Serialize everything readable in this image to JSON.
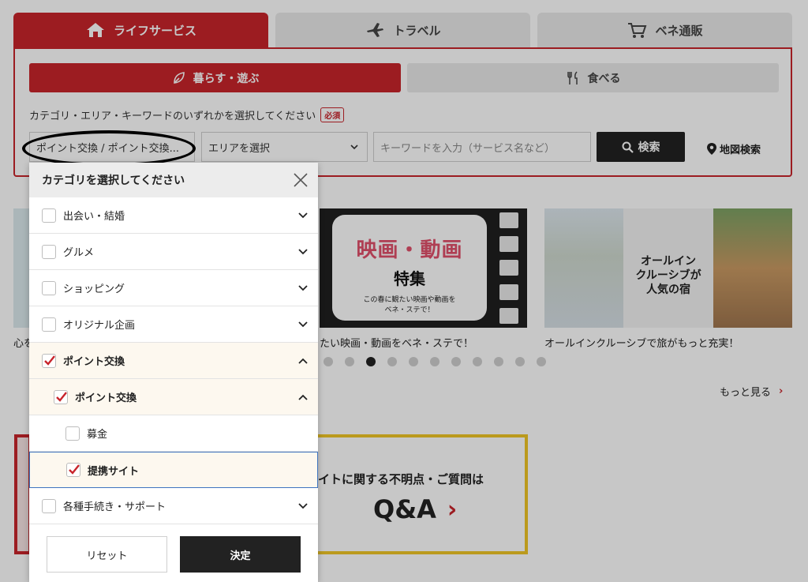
{
  "top_tabs": {
    "life": "ライフサービス",
    "travel": "トラベル",
    "shopping": "ベネ通販"
  },
  "sub_tabs": {
    "live_play": "暮らす・遊ぶ",
    "eat": "食べる"
  },
  "search": {
    "instruction": "カテゴリ・エリア・キーワードのいずれかを選択してください",
    "required_badge": "必須",
    "category_value": "ポイント交換 / ポイント交換...",
    "area_placeholder": "エリアを選択",
    "keyword_placeholder": "キーワードを入力（サービス名など）",
    "search_button": "検索",
    "map_search": "地図検索"
  },
  "carousel": {
    "left_caption": "心を",
    "movie_title": "映画・動画",
    "movie_feature": "特集",
    "movie_note_1": "この春に観たい映画や動画を",
    "movie_note_2": "ベネ・ステで！",
    "movie_caption": "たい映画・動画をベネ・ステで！",
    "cruise_headline_1": "オールイン",
    "cruise_headline_2": "クルーシブが",
    "cruise_headline_3": "人気の宿",
    "cruise_caption": "オールインクルーシブで旅がもっと充実！",
    "dot_count": 11,
    "active_dot": 2,
    "more_link": "もっと見る"
  },
  "qa_banner": {
    "text": "イトに関する不明点・ご質問は",
    "big": "Q&A"
  },
  "modal": {
    "title": "カテゴリを選択してください",
    "items": [
      {
        "label": "出会い・結婚",
        "checked": false
      },
      {
        "label": "グルメ",
        "checked": false
      },
      {
        "label": "ショッピング",
        "checked": false
      },
      {
        "label": "オリジナル企画",
        "checked": false
      },
      {
        "label": "ポイント交換",
        "checked": true
      },
      {
        "label": "ポイント交換",
        "checked": true
      },
      {
        "label": "募金",
        "checked": false
      },
      {
        "label": "提携サイト",
        "checked": true
      },
      {
        "label": "各種手続き・サポート",
        "checked": false
      }
    ],
    "reset_button": "リセット",
    "confirm_button": "決定"
  },
  "colors": {
    "brand_red": "#c8242b",
    "dark": "#222222",
    "highlight_blue": "#3f74bf",
    "qa_yellow": "#f0c626"
  }
}
